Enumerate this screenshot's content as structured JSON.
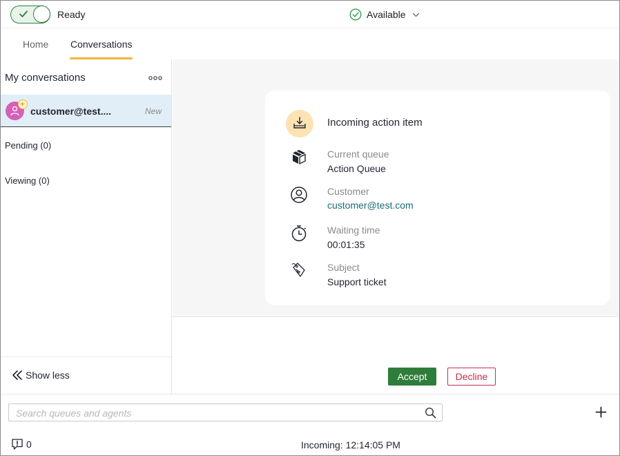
{
  "topbar": {
    "status_label": "Ready",
    "presence_label": "Available",
    "toggle_on": true
  },
  "tabs": [
    {
      "label": "Home",
      "active": false
    },
    {
      "label": "Conversations",
      "active": true
    }
  ],
  "sidebar": {
    "header": "My conversations",
    "conversation": {
      "email": "customer@test....",
      "tag": "New"
    },
    "pending_label": "Pending (0)",
    "viewing_label": "Viewing (0)",
    "show_less_label": "Show less"
  },
  "card": {
    "title": "Incoming action item",
    "rows": [
      {
        "icon": "box-icon",
        "label": "Current queue",
        "value": "Action Queue"
      },
      {
        "icon": "user-circle-icon",
        "label": "Customer",
        "value": "customer@test.com"
      },
      {
        "icon": "stopwatch-icon",
        "label": "Waiting time",
        "value": "00:01:35"
      },
      {
        "icon": "tag-icon",
        "label": "Subject",
        "value": "Support ticket"
      }
    ]
  },
  "actions": {
    "accept_label": "Accept",
    "decline_label": "Decline"
  },
  "bottom": {
    "search_placeholder": "Search queues and agents",
    "notification_count": "0",
    "incoming_status": "Incoming: 12:14:05 PM"
  },
  "colors": {
    "accent_green": "#2e7d3a",
    "decline_red": "#c0304a",
    "tab_underline": "#f2b535",
    "avatar": "#d85fb8",
    "link": "#1d6b73"
  }
}
